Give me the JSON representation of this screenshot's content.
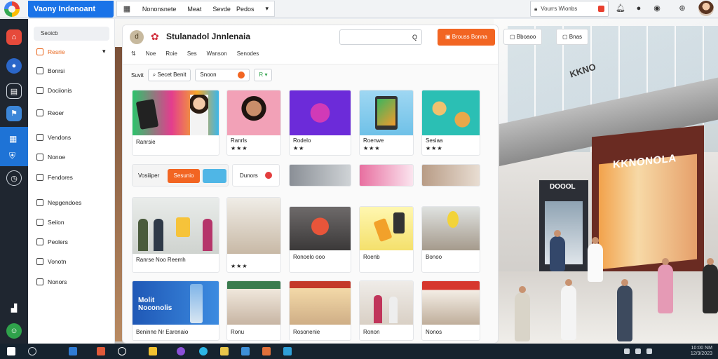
{
  "topbar": {
    "brand": "Vaony Indenoant",
    "tabs": [
      "Nononsnete",
      "Meat",
      "Sevde",
      "Pedos"
    ],
    "search_text": "Vourrs Wionbs"
  },
  "rail": {
    "icons": [
      "store-icon",
      "user-icon",
      "calendar-icon",
      "map-icon",
      "grid-icon",
      "shield-icon",
      "clock-icon",
      "building-icon",
      "profile-icon"
    ]
  },
  "sidebar": {
    "search": "Seoicb",
    "items": [
      {
        "label": "Resrie",
        "icon": "cart-icon",
        "highlight": true
      },
      {
        "label": "Bonrsi",
        "icon": "document-icon"
      },
      {
        "label": "Dociionis",
        "icon": "folder-icon"
      },
      {
        "label": "Reoer",
        "icon": "tag-icon"
      },
      {
        "label": "Vendons",
        "icon": "box-icon"
      },
      {
        "label": "Nonoe",
        "icon": "shield-icon"
      },
      {
        "label": "Fendores",
        "icon": "settings-icon"
      },
      {
        "label": "Nepgendoes",
        "icon": "chart-icon"
      },
      {
        "label": "Seiion",
        "icon": "list-icon"
      },
      {
        "label": "Peolers",
        "icon": "user-icon"
      },
      {
        "label": "Vonotn",
        "icon": "shop-icon"
      },
      {
        "label": "Nonors",
        "icon": "calendar-icon"
      }
    ]
  },
  "top_right": {
    "btn1": "Bboaoo",
    "btn2": "Bnas"
  },
  "panel": {
    "logo": "d",
    "title": "Stulanadol Jnnlenaia",
    "subtabs": [
      "Noe",
      "Roie",
      "Ses",
      "Wanson",
      "Senodes"
    ],
    "search_value": "Q",
    "orange_btn": "Brouss Bonna",
    "filter_label": "Suvit",
    "chip1": "Secet Benit",
    "chip2": "Snoon",
    "chip3": "R"
  },
  "cards_row1": [
    {
      "title": "Ranrsie",
      "img": "banner-phone",
      "stars": ""
    },
    {
      "title": "Ranrls",
      "img": "woman-portrait",
      "stars": "★★★"
    },
    {
      "title": "Rodelo",
      "img": "bowl-toy",
      "stars": "★★"
    },
    {
      "title": "Roenwe",
      "img": "tablet",
      "stars": "★★★"
    },
    {
      "title": "Sesiaa",
      "img": "food-bowls",
      "stars": "★★★"
    }
  ],
  "banners": {
    "b1_label": "Vosiiiper",
    "b1_btn": "Sesunio",
    "b2_label": "Dunors"
  },
  "cards_row2": [
    {
      "title": "Ranrse Noo Reemh",
      "img": "mall-people"
    },
    {
      "title": "",
      "img": "mall-interior",
      "stars": "★★★"
    },
    {
      "title": "Ronoelo ooo",
      "img": "mascot-store"
    },
    {
      "title": "Roenb",
      "img": "yellow-phone"
    },
    {
      "title": "Bonoo",
      "img": "mall-atrium"
    }
  ],
  "cards_row3": [
    {
      "title": "Beninne Nr Earenaio",
      "img": "blue-ad",
      "overlay": "Molit Noconolis"
    },
    {
      "title": "Ronu",
      "img": "storefront-a"
    },
    {
      "title": "Rosonenie",
      "img": "storefront-b"
    },
    {
      "title": "Ronon",
      "img": "shoppers"
    },
    {
      "title": "Nonos",
      "img": "mall-shop"
    }
  ],
  "mall": {
    "sign_big": "KKNONOLA",
    "sign_mid": "DOOOL",
    "sign_top": "KKNO"
  },
  "taskbar": {
    "time": "10:00 NM",
    "date": "12/9/2023"
  },
  "colors": {
    "accent": "#1a73e8",
    "orange": "#f26522",
    "rail": "#1f2630",
    "taskbar": "#16232f"
  }
}
